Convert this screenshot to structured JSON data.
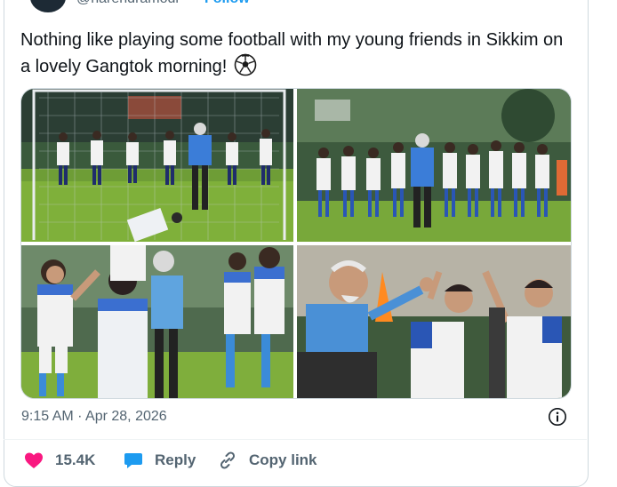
{
  "author": {
    "handle": "@narendramodi",
    "follow_label": "Follow"
  },
  "tweet": {
    "text": "Nothing like playing some football with my young friends in Sikkim on a lovely Gangtok morning!",
    "emoji_icon": "soccer-ball-icon"
  },
  "media": {
    "photos": [
      {
        "name": "photo-football-goal-group"
      },
      {
        "name": "photo-team-jogging"
      },
      {
        "name": "photo-high-five-girl"
      },
      {
        "name": "photo-high-five-boys"
      }
    ]
  },
  "meta": {
    "timestamp": "9:15 AM · Apr 28, 2026",
    "info_icon": "info-icon"
  },
  "actions": {
    "like_count": "15.4K",
    "reply_label": "Reply",
    "copy_label": "Copy link"
  },
  "colors": {
    "like": "#f91880",
    "reply": "#1d9bf0",
    "link": "#1d9bf0",
    "muted": "#536471"
  }
}
